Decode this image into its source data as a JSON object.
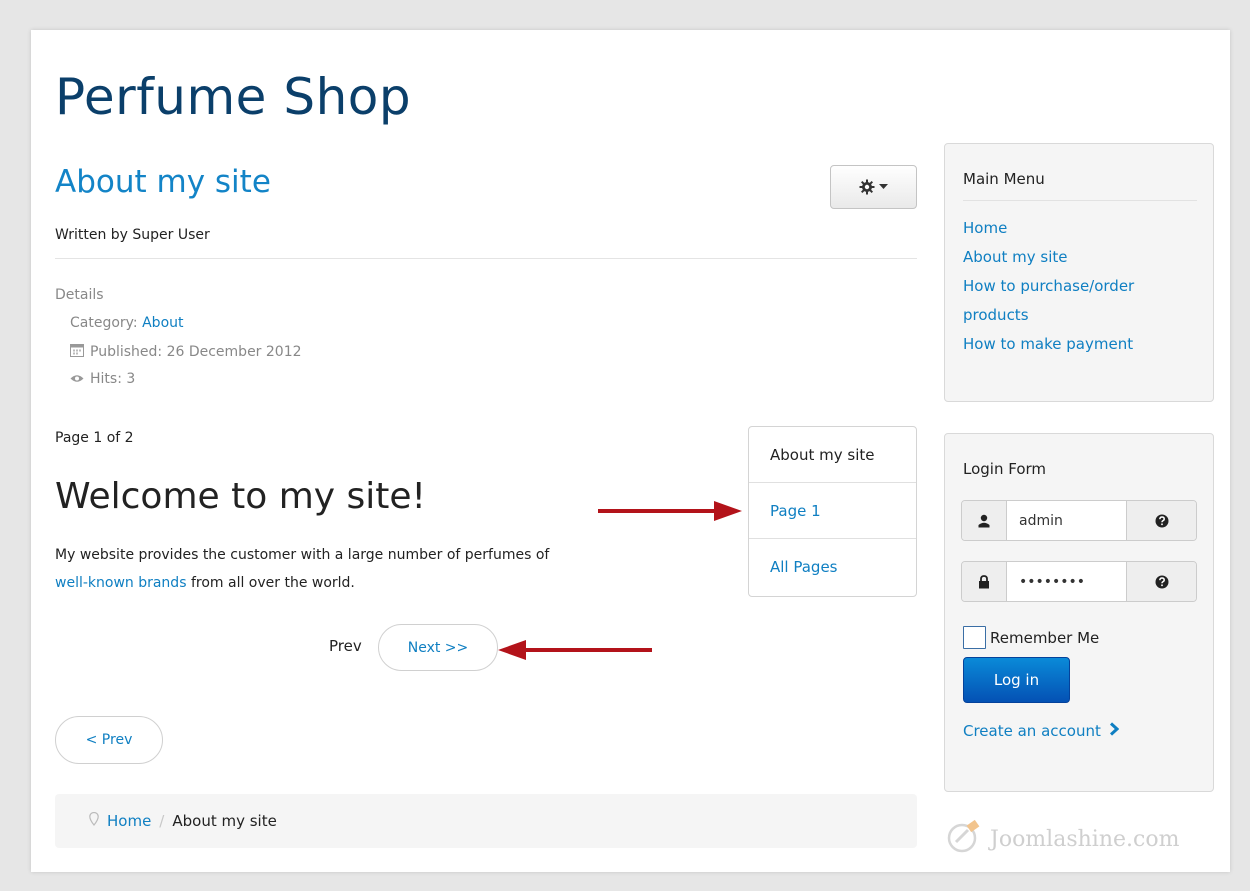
{
  "site": {
    "title": "Perfume Shop"
  },
  "article": {
    "title": "About my site",
    "byline": "Written by Super User",
    "details_label": "Details",
    "category_label": "Category:",
    "category_value": "About",
    "published": "Published: 26 December 2012",
    "hits": "Hits: 3",
    "page_count": "Page 1 of 2",
    "heading": "Welcome to my site!",
    "body_before_link": "My website provides the customer with a large number of perfumes of",
    "body_link": "well-known brands",
    "body_after_link": "from all over the world."
  },
  "toc": {
    "items": [
      {
        "label": "About my site"
      },
      {
        "label": "Page 1"
      },
      {
        "label": "All Pages"
      }
    ]
  },
  "pagination": {
    "prev_label": "Prev",
    "next_label": "Next >>",
    "prev_article_label": "< Prev"
  },
  "breadcrumb": {
    "home": "Home",
    "separator": "/",
    "current": "About my site"
  },
  "main_menu": {
    "title": "Main Menu",
    "items": [
      {
        "label": "Home"
      },
      {
        "label": "About my site"
      },
      {
        "label": "How to purchase/order products"
      },
      {
        "label": "How to make payment"
      }
    ]
  },
  "login_form": {
    "title": "Login Form",
    "username_value": "admin",
    "password_value": "••••••••",
    "remember_label": "Remember Me",
    "login_button": "Log in",
    "create_account": "Create an account"
  },
  "watermark": {
    "text": "Joomlashine.com"
  },
  "icons": {
    "gear": "gear-icon",
    "caret": "caret-down-icon",
    "calendar": "calendar-icon",
    "eye": "eye-icon",
    "user": "user-icon",
    "lock": "lock-icon",
    "help": "help-icon",
    "chevron": "chevron-right-icon",
    "location": "location-pin-icon"
  },
  "colors": {
    "link": "#0f7fc2",
    "site_title": "#0b3f6a",
    "annotation_arrow": "#b3131a",
    "login_button": "#0a6cc8"
  }
}
